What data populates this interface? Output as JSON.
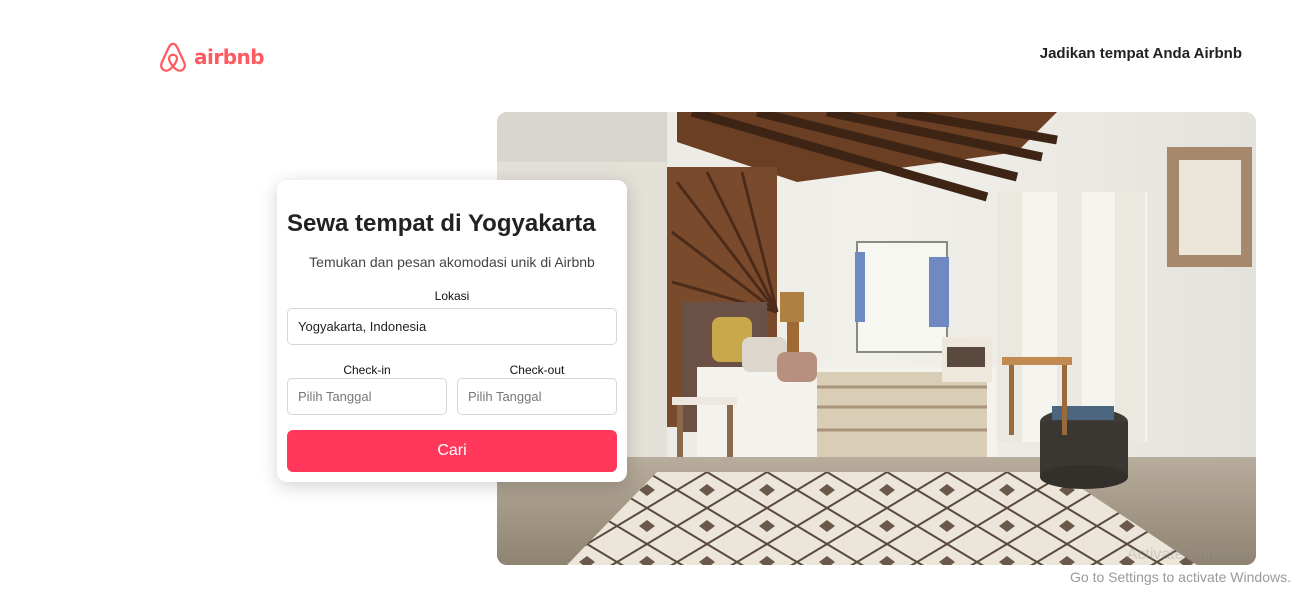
{
  "header": {
    "logo_text": "airbnb",
    "host_link": "Jadikan tempat Anda Airbnb"
  },
  "search_card": {
    "title": "Sewa tempat di Yogyakarta",
    "subtitle": "Temukan dan pesan akomodasi unik di Airbnb",
    "location_label": "Lokasi",
    "location_value": "Yogyakarta, Indonesia",
    "checkin_label": "Check-in",
    "checkin_placeholder": "Pilih Tanggal",
    "checkout_label": "Check-out",
    "checkout_placeholder": "Pilih Tanggal",
    "search_button": "Cari"
  },
  "os_watermark": {
    "title": "Activate Windows",
    "text": "Go to Settings to activate Windows."
  },
  "colors": {
    "brand": "#ff5a5f",
    "button": "#ff385c"
  }
}
